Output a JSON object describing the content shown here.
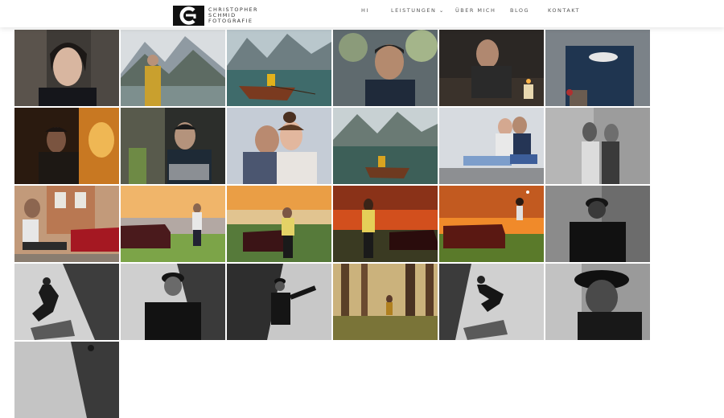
{
  "brand": {
    "line1": "CHRISTOPHER",
    "line2": "SCHMID",
    "line3": "FOTOGRAFIE",
    "logo_icon": "cs-monogram-logo"
  },
  "nav": {
    "items": [
      {
        "label": "HI"
      },
      {
        "label": "LEISTUNGEN ⌄"
      },
      {
        "label": "ÜBER MICH"
      },
      {
        "label": "BLOG"
      },
      {
        "label": "KONTAKT"
      }
    ]
  },
  "gallery": {
    "photos": [
      {
        "subject": "woman portrait hands on face"
      },
      {
        "subject": "man plaid shirt mountain lake"
      },
      {
        "subject": "person in wooden boat mountain lake"
      },
      {
        "subject": "man portrait dusk"
      },
      {
        "subject": "man by candle light"
      },
      {
        "subject": "man t-shirt close up"
      },
      {
        "subject": "man at window sunset"
      },
      {
        "subject": "man with laptop"
      },
      {
        "subject": "couple embracing"
      },
      {
        "subject": "boat on lake with mountains"
      },
      {
        "subject": "couple sitting by wall"
      },
      {
        "subject": "couple black and white"
      },
      {
        "subject": "man sitting by red car"
      },
      {
        "subject": "classic car and man"
      },
      {
        "subject": "man by classic car sunset"
      },
      {
        "subject": "man sunset sky"
      },
      {
        "subject": "mustang at sunset"
      },
      {
        "subject": "man with cap black and white"
      },
      {
        "subject": "jumping man shadow"
      },
      {
        "subject": "man cap black and white"
      },
      {
        "subject": "shadow portrait wall"
      },
      {
        "subject": "man in forest"
      },
      {
        "subject": "jumping man shadow wall"
      },
      {
        "subject": "man with cap looking down"
      },
      {
        "subject": "man black and white partial"
      }
    ]
  }
}
